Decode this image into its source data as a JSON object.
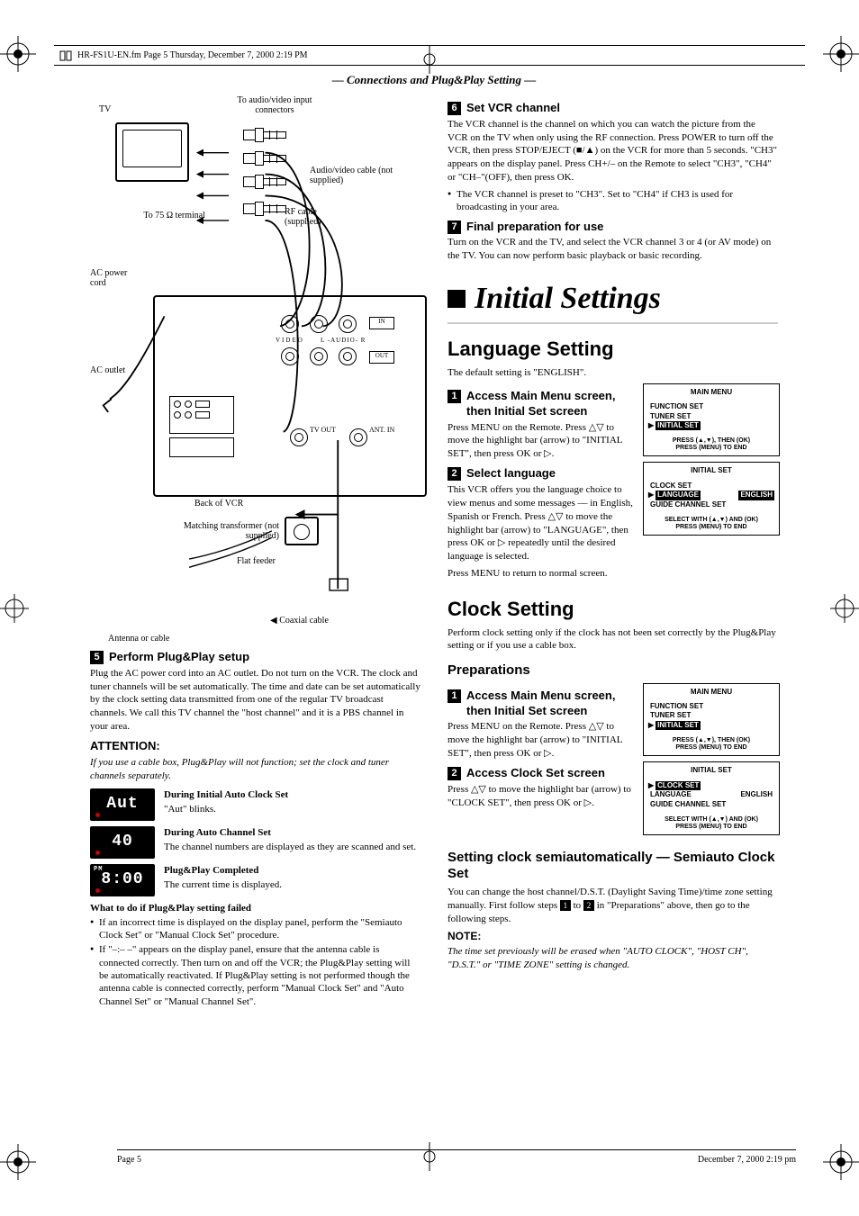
{
  "meta": {
    "header_file": "HR-FS1U-EN.fm  Page 5  Thursday, December 7, 2000  2:19 PM",
    "section_banner": "— Connections and Plug&Play Setting —",
    "footer_page": "Page 5",
    "footer_date": "December 7, 2000  2:19 pm"
  },
  "diagram": {
    "tv": "TV",
    "to_audio_video": "To audio/video input connectors",
    "av_cable": "Audio/video cable (not supplied)",
    "rf_cable": "RF cable (supplied)",
    "to_75": "To 75 Ω terminal",
    "ac_power_cord": "AC power cord",
    "ac_outlet": "AC outlet",
    "in": "IN",
    "out": "OUT",
    "video": "VIDEO",
    "audio": "AUDIO",
    "l": "L",
    "r": "R",
    "tv_out": "TV OUT",
    "ant_in": "ANT. IN",
    "back_of_vcr": "Back of VCR",
    "matching_transformer": "Matching transformer (not supplied)",
    "flat_feeder": "Flat feeder",
    "coaxial_cable": "Coaxial cable",
    "antenna_or_cable": "Antenna or cable"
  },
  "step5": {
    "num": "5",
    "title": "Perform Plug&Play setup",
    "body": "Plug the AC power cord into an AC outlet. Do not turn on the VCR. The clock and tuner channels will be set automatically. The time and date can be set automatically by the clock setting data transmitted from one of the regular TV broadcast channels. We call this TV channel the \"host channel\" and it is a PBS channel in your area.",
    "attention_label": "ATTENTION:",
    "attention_body": "If you use a cable box, Plug&Play will not function; set the clock and tuner channels separately.",
    "disp1_val": "Aut",
    "disp1_head": "During Initial Auto Clock Set",
    "disp1_body": "\"Aut\" blinks.",
    "disp2_val": "40",
    "disp2_head": "During Auto Channel Set",
    "disp2_body": "The channel numbers are displayed as they are scanned and set.",
    "disp3_val": "8:00",
    "disp3_pm": "PM",
    "disp3_head": "Plug&Play Completed",
    "disp3_body": "The current time is displayed.",
    "fail_head": "What to do if Plug&Play setting failed",
    "fail_b1": "If an incorrect time is displayed on the display panel, perform the \"Semiauto Clock Set\" or \"Manual Clock Set\" procedure.",
    "fail_b2": "If \"–:– –\" appears on the display panel, ensure that the antenna cable is connected correctly. Then turn on and off the VCR; the Plug&Play setting will be automatically reactivated. If Plug&Play setting is not performed though the antenna cable is connected correctly, perform \"Manual Clock Set\" and \"Auto Channel Set\" or \"Manual Channel Set\"."
  },
  "step6": {
    "num": "6",
    "title": "Set VCR channel",
    "body": "The VCR channel is the channel on which you can watch the picture from the VCR on the TV when only using the RF connection. Press POWER to turn off the VCR, then press STOP/EJECT (■/▲) on the VCR for more than 5 seconds. \"CH3\" appears on the display panel. Press CH+/– on the Remote to select \"CH3\", \"CH4\" or \"CH–\"(OFF), then press OK.",
    "bullet": "The VCR channel is preset to \"CH3\". Set to \"CH4\" if CH3 is used for broadcasting in your area."
  },
  "step7": {
    "num": "7",
    "title": "Final preparation for use",
    "body": "Turn on the VCR and the TV, and select the VCR channel 3 or 4 (or AV mode) on the TV. You can now perform basic playback or basic recording."
  },
  "initial_settings_heading": "Initial Settings",
  "language_setting": {
    "heading": "Language Setting",
    "intro": "The default setting is \"ENGLISH\".",
    "s1_num": "1",
    "s1_title": "Access Main Menu screen, then Initial Set screen",
    "s1_body": "Press MENU on the Remote. Press △▽ to move the highlight bar (arrow) to \"INITIAL SET\", then press OK or ▷.",
    "s2_num": "2",
    "s2_title": "Select language",
    "s2_body": "This VCR offers you the language choice to view menus and some messages — in English, Spanish or French. Press △▽ to move the highlight bar (arrow) to \"LANGUAGE\", then press OK or ▷ repeatedly until the desired language is selected.",
    "s2_body2": "Press MENU to return to normal screen."
  },
  "menus": {
    "main_menu_title": "MAIN MENU",
    "function_set": "FUNCTION SET",
    "tuner_set": "TUNER SET",
    "initial_set": "INITIAL SET",
    "press_then_ok": "PRESS (▲,▼), THEN (OK)",
    "press_menu_end": "PRESS (MENU) TO END",
    "initial_set_title": "INITIAL SET",
    "clock_set": "CLOCK SET",
    "language": "LANGUAGE",
    "english": "ENGLISH",
    "guide_channel": "GUIDE CHANNEL SET",
    "select_with": "SELECT WITH (▲,▼) AND (OK)"
  },
  "clock_setting": {
    "heading": "Clock Setting",
    "intro": "Perform clock setting only if the clock has not been set correctly by the Plug&Play setting or if you use a cable box.",
    "prep_heading": "Preparations",
    "s1_num": "1",
    "s1_title": "Access Main Menu screen, then Initial Set screen",
    "s1_body": "Press MENU on the Remote. Press △▽ to move the highlight bar (arrow) to \"INITIAL SET\", then press OK or ▷.",
    "s2_num": "2",
    "s2_title": "Access Clock Set screen",
    "s2_body": "Press △▽ to move the highlight bar (arrow) to \"CLOCK SET\", then press OK or ▷.",
    "semi_heading": "Setting clock semiautomatically — Semiauto Clock Set",
    "semi_body": "You can change the host channel/D.S.T. (Daylight Saving Time)/time zone setting manually. First follow steps 1 to 2 in \"Preparations\" above, then go to the following steps.",
    "note_label": "NOTE:",
    "note_body": "The time set previously will be erased when \"AUTO CLOCK\", \"HOST CH\", \"D.S.T.\" or \"TIME ZONE\" setting is changed."
  }
}
